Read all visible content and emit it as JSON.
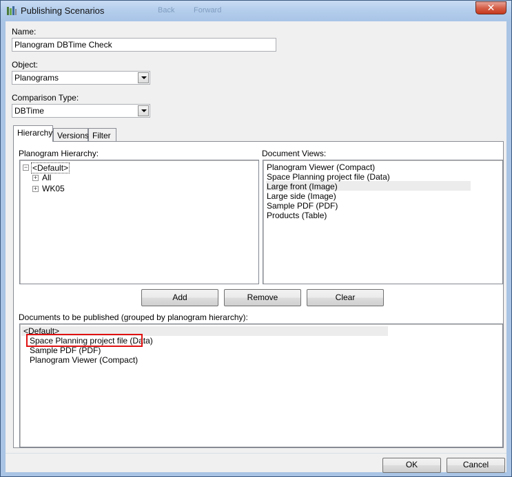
{
  "window": {
    "title": "Publishing Scenarios",
    "close_symbol": "✕",
    "ghost_toolbar": [
      "Back",
      "Forward"
    ]
  },
  "name": {
    "label": "Name:",
    "value": "Planogram DBTime Check"
  },
  "object": {
    "label": "Object:",
    "value": "Planograms"
  },
  "comparison": {
    "label": "Comparison Type:",
    "value": "DBTime"
  },
  "tabs": [
    {
      "label": "Hierarchy",
      "active": true
    },
    {
      "label": "Versions",
      "active": false
    },
    {
      "label": "Filter",
      "active": false
    }
  ],
  "hierarchy": {
    "label": "Planogram Hierarchy:",
    "root": "<Default>",
    "children": [
      "All",
      "WK05"
    ]
  },
  "document_views": {
    "label": "Document Views:",
    "items": [
      "Planogram Viewer (Compact)",
      "Space Planning project file (Data)",
      "Large front (Image)",
      "Large side (Image)",
      "Sample PDF (PDF)",
      "Products (Table)"
    ]
  },
  "actions": {
    "add": "Add",
    "remove": "Remove",
    "clear": "Clear"
  },
  "published": {
    "label": "Documents to be published (grouped by planogram hierarchy):",
    "group": "<Default>",
    "items": [
      "Space Planning project file (Data)",
      "Sample PDF (PDF)",
      "Planogram Viewer (Compact)"
    ]
  },
  "footer": {
    "ok": "OK",
    "cancel": "Cancel"
  },
  "colors": {
    "highlight": "#e01010",
    "titlebar": "#b3cdec",
    "dialog_bg": "#f0f0f0"
  }
}
